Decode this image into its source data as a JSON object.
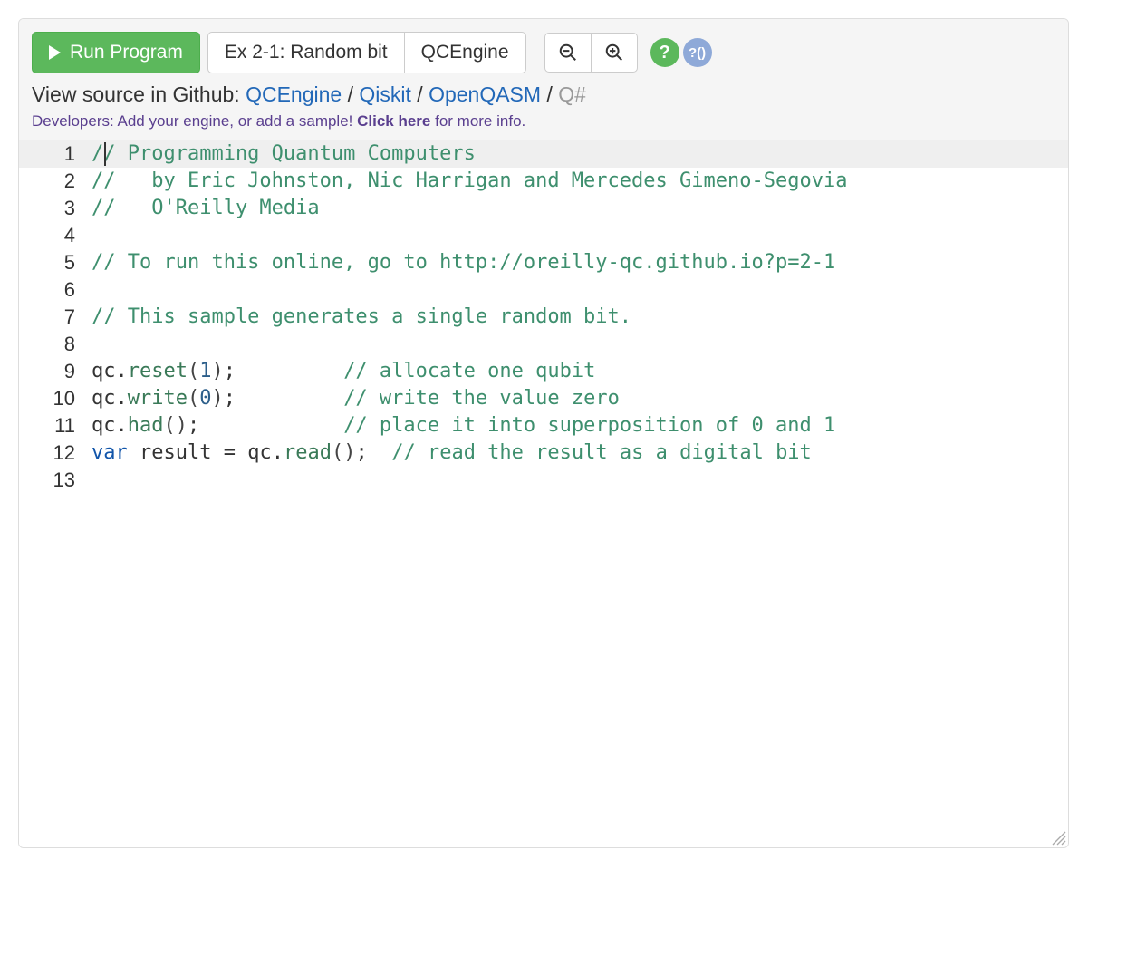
{
  "toolbar": {
    "run_label": "Run Program",
    "example_label": "Ex 2-1: Random bit",
    "engine_label": "QCEngine"
  },
  "help": {
    "help_glyph": "?",
    "ref_glyph": "?()"
  },
  "source_line": {
    "prefix": "View source in Github: ",
    "links": [
      "QCEngine",
      "Qiskit",
      "OpenQASM"
    ],
    "sep": " / ",
    "disabled": "Q#"
  },
  "dev_line": {
    "prefix": "Developers: Add your engine, or add a sample! ",
    "click_here": "Click here",
    "suffix": " for more info."
  },
  "code_lines": [
    {
      "n": 1,
      "tokens": [
        [
          "comment",
          "// Programming Quantum Computers"
        ]
      ]
    },
    {
      "n": 2,
      "tokens": [
        [
          "comment",
          "//   by Eric Johnston, Nic Harrigan and Mercedes Gimeno-Segovia"
        ]
      ]
    },
    {
      "n": 3,
      "tokens": [
        [
          "comment",
          "//   O'Reilly Media"
        ]
      ]
    },
    {
      "n": 4,
      "tokens": []
    },
    {
      "n": 5,
      "tokens": [
        [
          "comment",
          "// To run this online, go to http://oreilly-qc.github.io?p=2-1"
        ]
      ]
    },
    {
      "n": 6,
      "tokens": []
    },
    {
      "n": 7,
      "tokens": [
        [
          "comment",
          "// This sample generates a single random bit."
        ]
      ]
    },
    {
      "n": 8,
      "tokens": []
    },
    {
      "n": 9,
      "tokens": [
        [
          "ident",
          "qc"
        ],
        [
          "plain",
          "."
        ],
        [
          "func",
          "reset"
        ],
        [
          "paren",
          "("
        ],
        [
          "num",
          "1"
        ],
        [
          "paren",
          ")"
        ],
        [
          "plain",
          ";         "
        ],
        [
          "comment",
          "// allocate one qubit"
        ]
      ]
    },
    {
      "n": 10,
      "tokens": [
        [
          "ident",
          "qc"
        ],
        [
          "plain",
          "."
        ],
        [
          "func",
          "write"
        ],
        [
          "paren",
          "("
        ],
        [
          "num",
          "0"
        ],
        [
          "paren",
          ")"
        ],
        [
          "plain",
          ";         "
        ],
        [
          "comment",
          "// write the value zero"
        ]
      ]
    },
    {
      "n": 11,
      "tokens": [
        [
          "ident",
          "qc"
        ],
        [
          "plain",
          "."
        ],
        [
          "func",
          "had"
        ],
        [
          "paren",
          "()"
        ],
        [
          "plain",
          ";            "
        ],
        [
          "comment",
          "// place it into superposition of 0 and 1"
        ]
      ]
    },
    {
      "n": 12,
      "tokens": [
        [
          "kw",
          "var"
        ],
        [
          "plain",
          " "
        ],
        [
          "ident",
          "result"
        ],
        [
          "plain",
          " = "
        ],
        [
          "ident",
          "qc"
        ],
        [
          "plain",
          "."
        ],
        [
          "func",
          "read"
        ],
        [
          "paren",
          "()"
        ],
        [
          "plain",
          ";  "
        ],
        [
          "comment",
          "// read the result as a digital bit"
        ]
      ]
    },
    {
      "n": 13,
      "tokens": []
    }
  ]
}
